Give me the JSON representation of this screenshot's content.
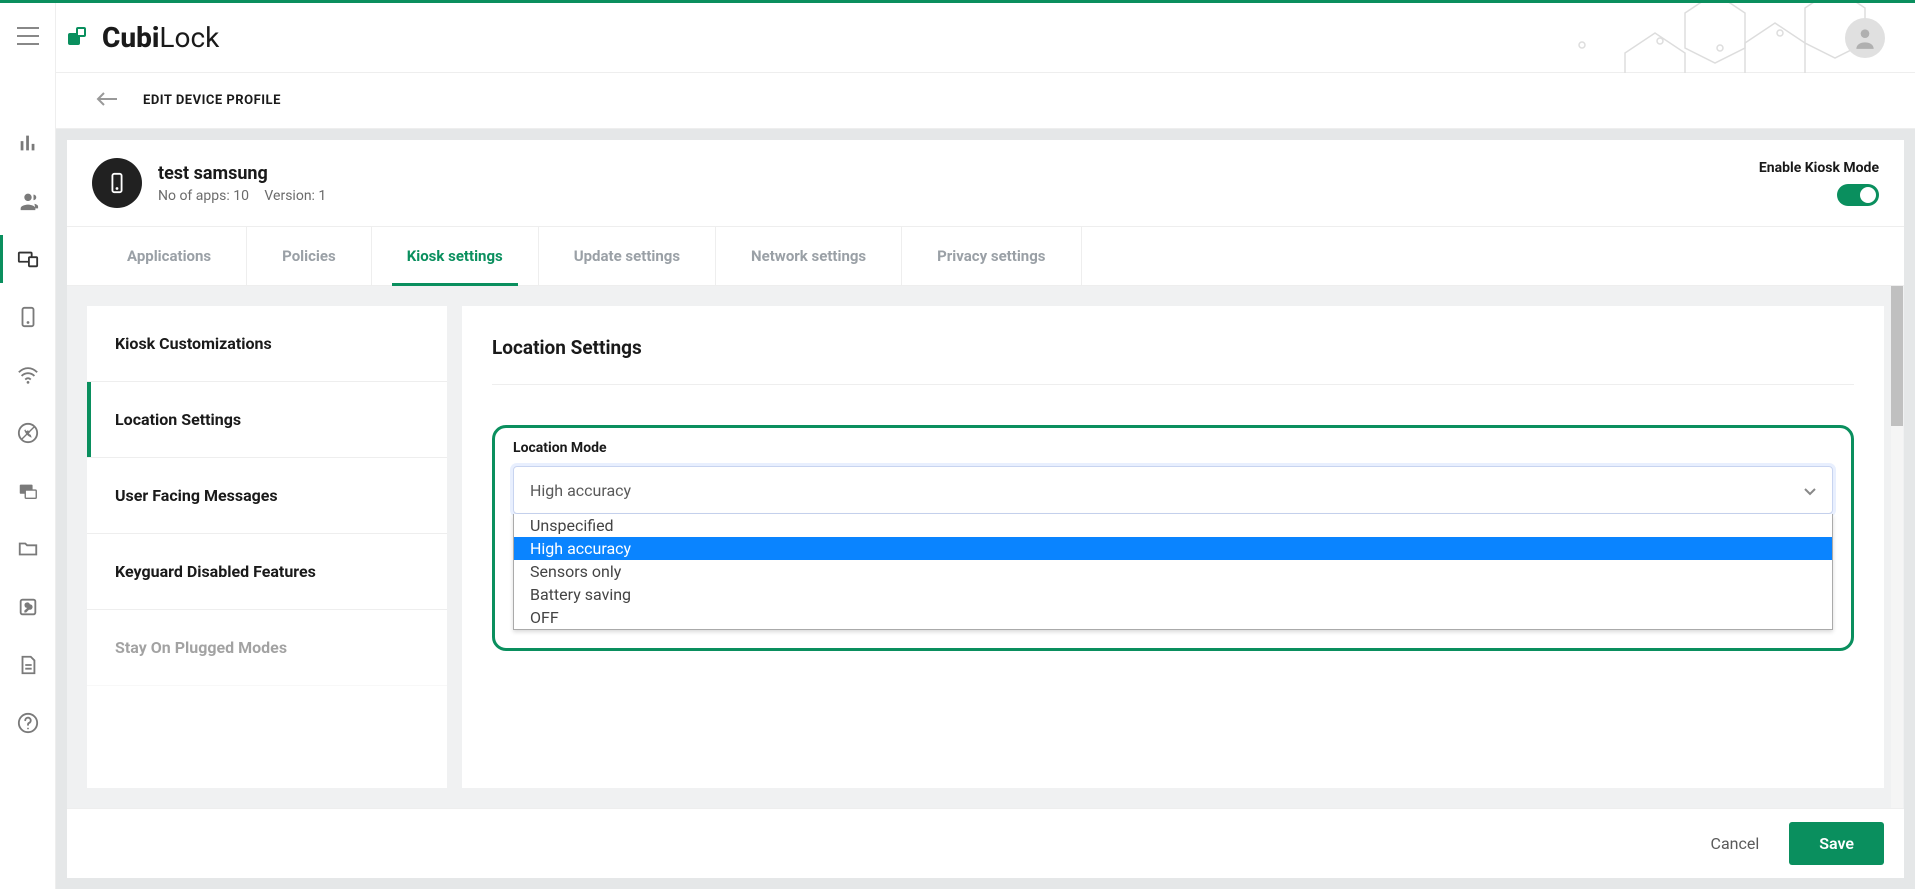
{
  "brand": {
    "name_bold": "Cubi",
    "name_light": "Lock"
  },
  "subheader": {
    "title": "EDIT DEVICE PROFILE"
  },
  "profile": {
    "name": "test samsung",
    "apps_label": "No of apps: 10",
    "version_label": "Version: 1",
    "kiosk_label": "Enable Kiosk Mode"
  },
  "tabs": [
    {
      "label": "Applications",
      "active": false
    },
    {
      "label": "Policies",
      "active": false
    },
    {
      "label": "Kiosk settings",
      "active": true
    },
    {
      "label": "Update settings",
      "active": false
    },
    {
      "label": "Network settings",
      "active": false
    },
    {
      "label": "Privacy settings",
      "active": false
    }
  ],
  "settings_sidebar": [
    {
      "label": "Kiosk Customizations",
      "active": false
    },
    {
      "label": "Location Settings",
      "active": true
    },
    {
      "label": "User Facing Messages",
      "active": false
    },
    {
      "label": "Keyguard Disabled Features",
      "active": false
    },
    {
      "label": "Stay On Plugged Modes",
      "active": false
    }
  ],
  "settings_panel": {
    "title": "Location Settings",
    "field_label": "Location Mode",
    "selected_value": "High accuracy",
    "options": [
      {
        "label": "Unspecified",
        "selected": false
      },
      {
        "label": "High accuracy",
        "selected": true
      },
      {
        "label": "Sensors only",
        "selected": false
      },
      {
        "label": "Battery saving",
        "selected": false
      },
      {
        "label": "OFF",
        "selected": false
      }
    ]
  },
  "footer": {
    "cancel": "Cancel",
    "save": "Save"
  },
  "sidebar_icons": [
    "dashboard-icon",
    "users-icon",
    "devices-icon",
    "mobile-icon",
    "wifi-icon",
    "blocked-call-icon",
    "chat-icon",
    "folder-icon",
    "key-icon",
    "document-icon",
    "help-icon"
  ]
}
